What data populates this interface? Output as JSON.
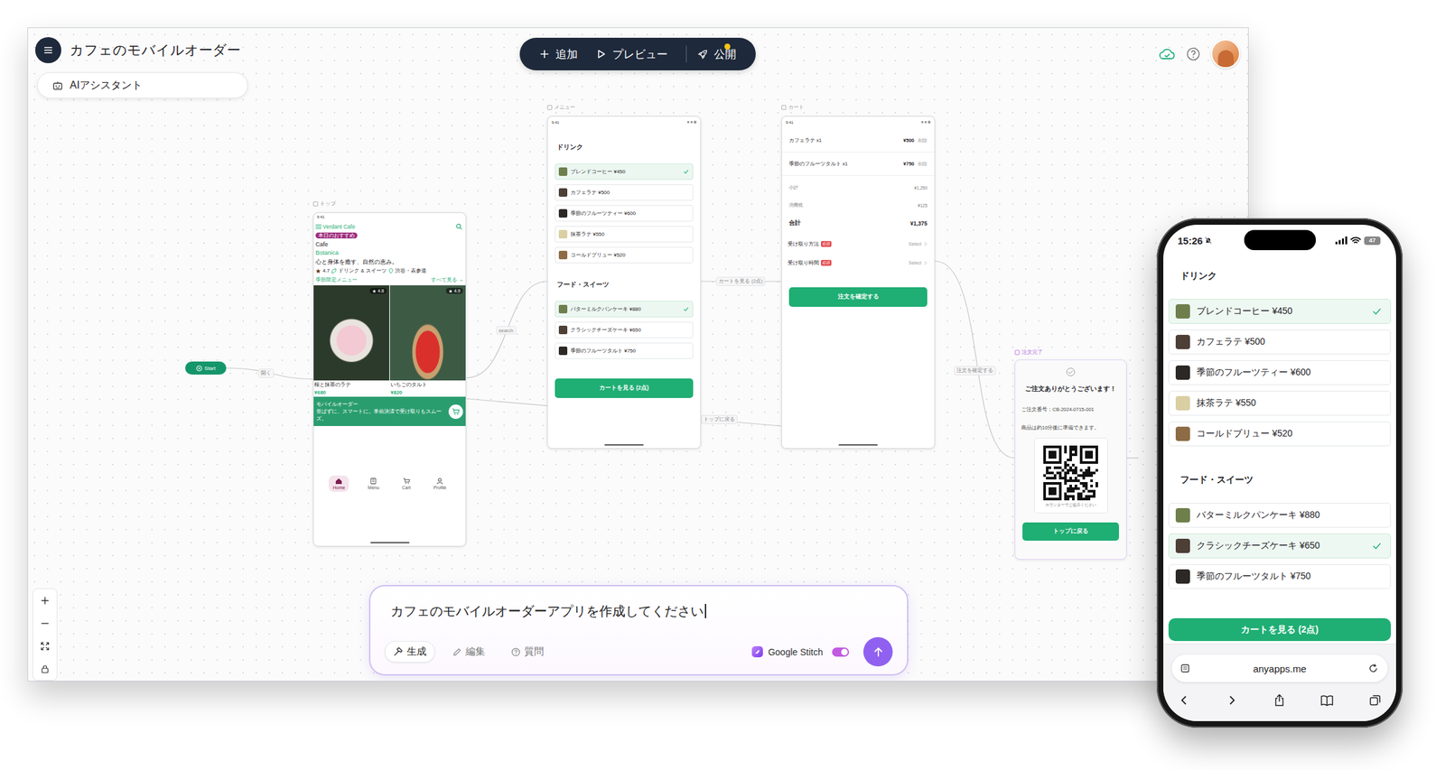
{
  "app": {
    "title": "カフェのモバイルオーダー",
    "ai_assistant": "AIアシスタント",
    "synced": true
  },
  "toolbar": [
    {
      "label": "追加",
      "kind": "add",
      "notification": false
    },
    {
      "label": "プレビュー",
      "kind": "preview",
      "notification": false
    },
    {
      "label": "公開",
      "kind": "publish",
      "notification": true
    }
  ],
  "canvas": {
    "start": "Start",
    "edges": [
      {
        "label": "開く"
      },
      {
        "label": "search"
      },
      {
        "label": "カートを見る (2点)"
      },
      {
        "label": "トップに戻る"
      },
      {
        "label": "注文を確定する"
      }
    ],
    "top": {
      "frame_label": "トップ",
      "selected": false,
      "time": "9:41",
      "brand": "Verdant Cafe",
      "badge": "本日のおすすめ",
      "title_lines": [
        "Cafe",
        "Botanica"
      ],
      "tagline": "心と身体を癒す、自然の恵み。",
      "rating": "4.7",
      "category": "ドリンク & スイーツ",
      "location": "渋谷・表参道",
      "section": "季節限定メニュー",
      "see_all": "すべて見る →",
      "cards": [
        {
          "name": "桜と抹茶のラテ",
          "price": "¥680",
          "rating": "4.8"
        },
        {
          "name": "いちごのタルト",
          "price": "¥820",
          "rating": "4.9"
        }
      ],
      "banner": {
        "title": "モバイルオーダー",
        "text": "並ばずに、スマートに。事前決済で受け取りもスムーズ。"
      },
      "nav": [
        {
          "label": "Home",
          "kind": "home",
          "selected": true
        },
        {
          "label": "Menu",
          "kind": "menu",
          "selected": false
        },
        {
          "label": "Cart",
          "kind": "cart",
          "selected": false
        },
        {
          "label": "Profile",
          "kind": "profile",
          "selected": false
        }
      ]
    },
    "menu": {
      "frame_label": "メニュー",
      "selected": false,
      "time": "9:41",
      "sections": [
        {
          "title": "ドリンク",
          "items": [
            {
              "label": "ブレンドコーヒー ¥450",
              "selected": true
            },
            {
              "label": "カフェラテ ¥500",
              "selected": false
            },
            {
              "label": "季節のフルーツティー ¥600",
              "selected": false
            },
            {
              "label": "抹茶ラテ ¥550",
              "selected": false
            },
            {
              "label": "コールドブリュー ¥520",
              "selected": false
            }
          ]
        },
        {
          "title": "フード・スイーツ",
          "items": [
            {
              "label": "バターミルクパンケーキ ¥880",
              "selected": true
            },
            {
              "label": "クラシックチーズケーキ ¥650",
              "selected": false
            },
            {
              "label": "季節のフルーツタルト ¥750",
              "selected": false
            }
          ]
        }
      ],
      "button": "カートを見る (2点)"
    },
    "cart": {
      "frame_label": "カート",
      "selected": false,
      "time": "9:41",
      "items": [
        {
          "name": "カフェラテ x1",
          "price": "¥500",
          "remove": "削除"
        },
        {
          "name": "季節のフルーツタルト x1",
          "price": "¥750",
          "remove": "削除"
        }
      ],
      "summary": [
        {
          "label": "小計",
          "value": "¥1,250",
          "total": false
        },
        {
          "label": "消費税",
          "value": "¥125",
          "total": false
        },
        {
          "label": "合計",
          "value": "¥1,375",
          "total": true
        }
      ],
      "options": [
        {
          "label": "受け取り方法",
          "required": "必須",
          "value": "Select"
        },
        {
          "label": "受け取り時間",
          "required": "必須",
          "value": "Select"
        }
      ],
      "button": "注文を確定する"
    },
    "complete": {
      "frame_label": "注文完了",
      "selected": true,
      "title": "ご注文ありがとうございます！",
      "order_number": "ご注文番号：CB-2024-0715-001",
      "note": "商品は約10分後に準備できます。",
      "qr_caption": "カウンターでご提示ください",
      "button": "トップに戻る"
    }
  },
  "prompt": {
    "text": "カフェのモバイルオーダーアプリを作成してください",
    "modes": [
      {
        "label": "生成",
        "kind": "generate",
        "selected": true
      },
      {
        "label": "編集",
        "kind": "edit",
        "selected": false
      },
      {
        "label": "質問",
        "kind": "ask",
        "selected": false
      }
    ],
    "stitch": {
      "label": "Google Stitch",
      "on": true
    }
  },
  "phone": {
    "time": "15:26",
    "silent": true,
    "battery": "47",
    "sections": [
      {
        "title": "ドリンク",
        "items": [
          {
            "label": "ブレンドコーヒー ¥450",
            "selected": true
          },
          {
            "label": "カフェラテ ¥500",
            "selected": false
          },
          {
            "label": "季節のフルーツティー ¥600",
            "selected": false
          },
          {
            "label": "抹茶ラテ ¥550",
            "selected": false
          },
          {
            "label": "コールドブリュー ¥520",
            "selected": false
          }
        ]
      },
      {
        "title": "フード・スイーツ",
        "items": [
          {
            "label": "バターミルクパンケーキ ¥880",
            "selected": false
          },
          {
            "label": "クラシックチーズケーキ ¥650",
            "selected": true
          },
          {
            "label": "季節のフルーツタルト ¥750",
            "selected": false
          }
        ]
      }
    ],
    "button": "カートを見る (2点)",
    "url": "anyapps.me"
  }
}
